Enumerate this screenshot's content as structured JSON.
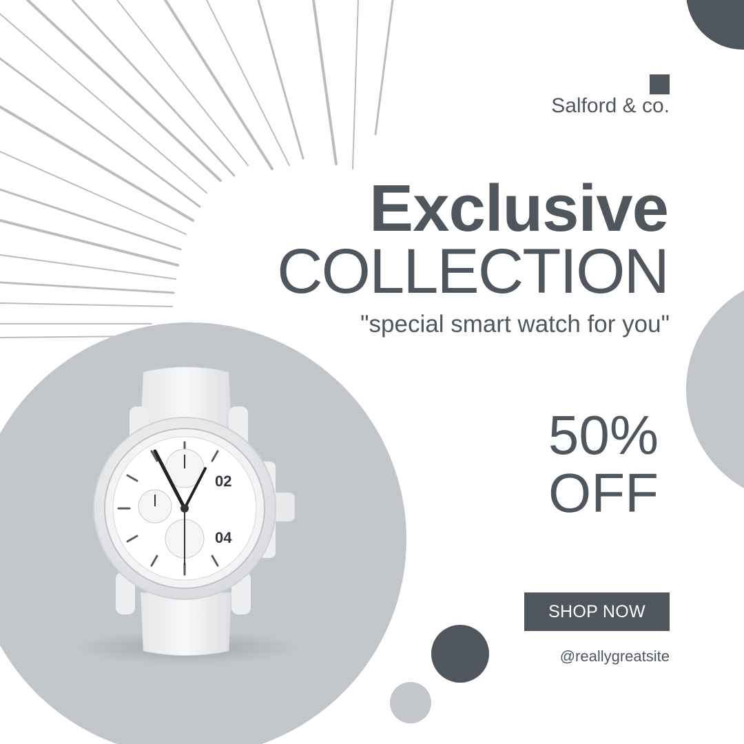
{
  "brand": {
    "name": "Salford & co."
  },
  "headline": {
    "line1": "Exclusive",
    "line2": "COLLECTION"
  },
  "tagline": "\"special smart watch for you\"",
  "offer": {
    "amount": "50%",
    "label": "OFF"
  },
  "cta": {
    "label": "SHOP NOW"
  },
  "website": "@reallygreatsite",
  "watch": {
    "sub_dial_top": "02",
    "sub_dial_bottom": "04"
  },
  "colors": {
    "dark": "#4f565e",
    "light_gray": "#c2c5ca",
    "background": "#ffffff"
  }
}
